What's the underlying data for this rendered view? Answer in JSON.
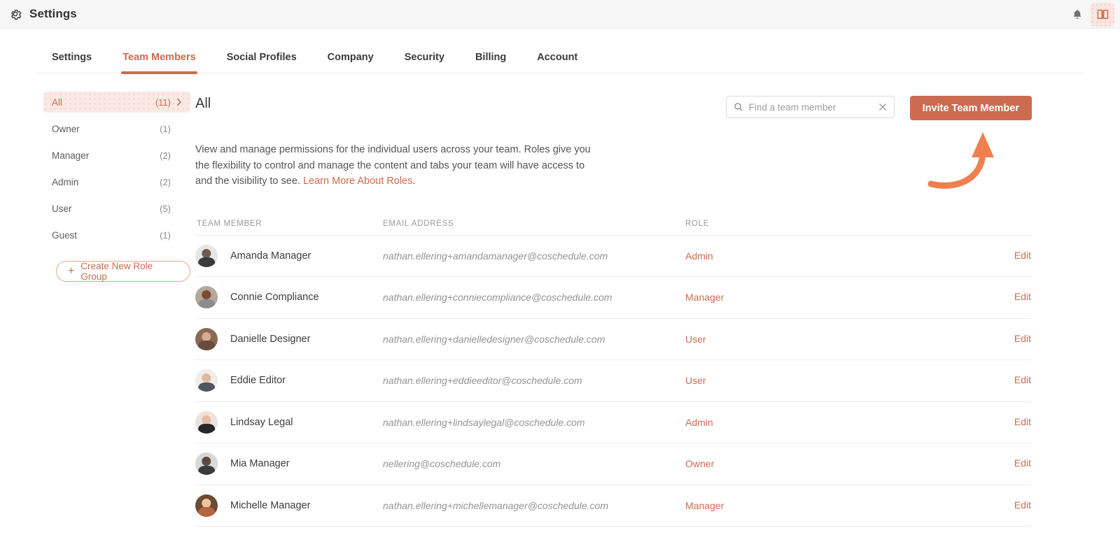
{
  "appbar": {
    "title": "Settings",
    "gear_icon": "gear-icon",
    "bell_icon": "bell-icon",
    "book_icon": "open-book-icon"
  },
  "tabs": [
    {
      "label": "Settings",
      "active": false
    },
    {
      "label": "Team Members",
      "active": true
    },
    {
      "label": "Social Profiles",
      "active": false
    },
    {
      "label": "Company",
      "active": false
    },
    {
      "label": "Security",
      "active": false
    },
    {
      "label": "Billing",
      "active": false
    },
    {
      "label": "Account",
      "active": false
    }
  ],
  "sidebar": {
    "items": [
      {
        "label": "All",
        "count": "(11)",
        "active": true,
        "chevron": true
      },
      {
        "label": "Owner",
        "count": "(1)",
        "active": false,
        "chevron": false
      },
      {
        "label": "Manager",
        "count": "(2)",
        "active": false,
        "chevron": false
      },
      {
        "label": "Admin",
        "count": "(2)",
        "active": false,
        "chevron": false
      },
      {
        "label": "User",
        "count": "(5)",
        "active": false,
        "chevron": false
      },
      {
        "label": "Guest",
        "count": "(1)",
        "active": false,
        "chevron": false
      }
    ],
    "create_role_label": "Create New Role Group",
    "plus_glyph": "+"
  },
  "main": {
    "section_title": "All",
    "blurb_text": "View and manage permissions for the individual users across your team. Roles give you the flexibility to control and manage the content and tabs your team will have access to and the visibility to see. ",
    "blurb_link": "Learn More About Roles",
    "blurb_tail": ".",
    "search": {
      "placeholder": "Find a team member",
      "value": "",
      "search_icon": "search-icon",
      "clear_icon": "clear-x-icon"
    },
    "invite_label": "Invite Team Member",
    "annotation": "curved-arrow-pointing-to-invite-button"
  },
  "table": {
    "headers": {
      "member": "TEAM MEMBER",
      "email": "EMAIL ADDRESS",
      "role": "ROLE",
      "action": ""
    },
    "edit_label": "Edit",
    "rows": [
      {
        "name": "Amanda Manager",
        "email": "nathan.ellering+amandamanager@coschedule.com",
        "role": "Admin",
        "edit": "Edit",
        "sky": "#e8e6e4",
        "head": "#6d5b52",
        "torso": "#3b3b3f"
      },
      {
        "name": "Connie Compliance",
        "email": "nathan.ellering+conniecompliance@coschedule.com",
        "role": "Manager",
        "edit": "Edit",
        "sky": "#b4a79c",
        "head": "#7a4a34",
        "torso": "#8a8c90"
      },
      {
        "name": "Danielle Designer",
        "email": "nathan.ellering+danielledesigner@coschedule.com",
        "role": "User",
        "edit": "Edit",
        "sky": "#8a6a56",
        "head": "#d8ab91",
        "torso": "#6a4b3c"
      },
      {
        "name": "Eddie Editor",
        "email": "nathan.ellering+eddieeditor@coschedule.com",
        "role": "User",
        "edit": "Edit",
        "sky": "#efeeec",
        "head": "#e0b99c",
        "torso": "#52555c"
      },
      {
        "name": "Lindsay Legal",
        "email": "nathan.ellering+lindsaylegal@coschedule.com",
        "role": "Admin",
        "edit": "Edit",
        "sky": "#efe2dd",
        "head": "#e3bba3",
        "torso": "#26262a"
      },
      {
        "name": "Mia Manager",
        "email": "nellering@coschedule.com",
        "role": "Owner",
        "edit": "Edit",
        "sky": "#d8d8d6",
        "head": "#5b4a42",
        "torso": "#3a3a40"
      },
      {
        "name": "Michelle Manager",
        "email": "nathan.ellering+michellemanager@coschedule.com",
        "role": "Manager",
        "edit": "Edit",
        "sky": "#6d4a34",
        "head": "#f0c3a6",
        "torso": "#b5643f"
      }
    ]
  },
  "colors": {
    "accent": "#cc6b50",
    "accent_light": "#fae9e4",
    "arrow": "#f07f4f",
    "text": "#3d3d3d",
    "muted": "#949494",
    "appbar_bg": "#f6f6f6",
    "border": "#ededed"
  }
}
